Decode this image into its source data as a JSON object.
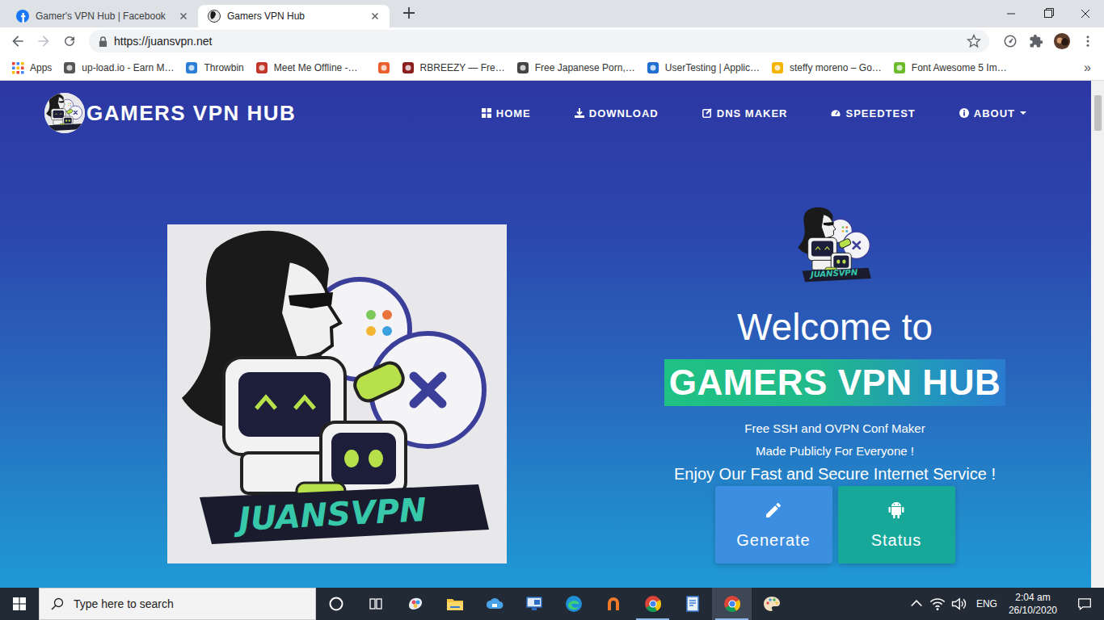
{
  "browser": {
    "tabs": [
      {
        "label": "Gamer's VPN Hub | Facebook",
        "selected": false
      },
      {
        "label": "Gamers VPN Hub",
        "selected": true
      }
    ],
    "address": "https://juansvpn.net",
    "bookmarks": [
      {
        "kind": "apps",
        "label": "Apps",
        "color": "#4285f4"
      },
      {
        "kind": "labeled",
        "label": "up-load.io - Earn M…",
        "color": "#555555"
      },
      {
        "kind": "labeled",
        "label": "Throwbin",
        "color": "#2a7fd4"
      },
      {
        "kind": "labeled",
        "label": "Meet Me Offline -…",
        "color": "#c0392b"
      },
      {
        "kind": "icon",
        "color": "#e8602c"
      },
      {
        "kind": "labeled",
        "label": "RBREEZY — Fre…",
        "color": "#8b1f1f"
      },
      {
        "kind": "labeled",
        "label": "Free Japanese Porn,…",
        "color": "#444444"
      },
      {
        "kind": "labeled",
        "label": "UserTesting | Applic…",
        "color": "#1f6fd1"
      },
      {
        "kind": "labeled",
        "label": "steffy moreno – Go…",
        "color": "#f4b400"
      },
      {
        "kind": "labeled",
        "label": "Font Awesome 5 Im…",
        "color": "#6cbb2c"
      }
    ],
    "bookmarks_more": "»"
  },
  "site": {
    "brand": "GAMERS VPN HUB",
    "nav": [
      {
        "label": "HOME",
        "dropdown": false
      },
      {
        "label": "DOWNLOAD",
        "dropdown": false
      },
      {
        "label": "DNS MAKER",
        "dropdown": false
      },
      {
        "label": "SPEEDTEST",
        "dropdown": false
      },
      {
        "label": "ABOUT",
        "dropdown": true
      }
    ],
    "hero": {
      "logo_caption": "JUANSVPN",
      "welcome": "Welcome to",
      "title": "GAMERS VPN HUB",
      "lines": [
        "Free SSH and OVPN Conf Maker",
        "Made Publicly For Everyone !"
      ],
      "tagline": "Enjoy Our Fast and Secure Internet Service !",
      "buttons": [
        {
          "label": "Generate",
          "color": "#3b8ee0"
        },
        {
          "label": "Status",
          "color": "#17a89a"
        }
      ]
    }
  },
  "taskbar": {
    "search_placeholder": "Type here to search",
    "apps": [
      {
        "kind": "paint3d",
        "running": false,
        "selected": false
      },
      {
        "kind": "explorer",
        "running": false,
        "selected": false
      },
      {
        "kind": "cloud",
        "running": false,
        "selected": false
      },
      {
        "kind": "monitor",
        "running": false,
        "selected": false
      },
      {
        "kind": "edge",
        "running": false,
        "selected": false
      },
      {
        "kind": "horseshoe",
        "running": false,
        "selected": false
      },
      {
        "kind": "chrome",
        "running": true,
        "selected": false
      },
      {
        "kind": "notes",
        "running": false,
        "selected": false
      },
      {
        "kind": "chrome",
        "running": true,
        "selected": true
      },
      {
        "kind": "palette",
        "running": false,
        "selected": false
      }
    ],
    "language": "ENG",
    "time": "2:04 am",
    "date": "26/10/2020"
  }
}
